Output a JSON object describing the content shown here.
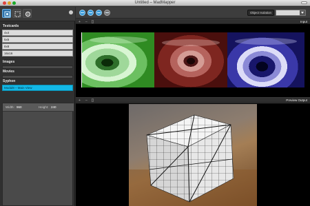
{
  "window": {
    "title": "Untitled – MadMapper"
  },
  "toolbar": {
    "tools": [
      {
        "name": "quad-tool-icon",
        "active": true
      },
      {
        "name": "mask-tool-icon",
        "active": false
      },
      {
        "name": "settings-tool-icon",
        "active": false
      }
    ]
  },
  "sidebar": {
    "testcards_label": "Testcards",
    "testcards": [
      "4x4",
      "5x5",
      "8x8",
      "16x16"
    ],
    "images_label": "Images",
    "movies_label": "Movies",
    "syphon_label": "Syphon",
    "syphon_items": [
      "Modul8 – Main View"
    ],
    "selected_syphon": 0,
    "width_label": "Width:",
    "width_value": "960",
    "height_label": "Height:",
    "height_value": "240"
  },
  "main": {
    "object_isolation_label": "Object Isolation",
    "input_pane_title": "Input",
    "preview_pane_title": "Preview Output",
    "pane_controls": [
      "+",
      "–",
      "[]"
    ]
  },
  "colors": {
    "accent": "#13b8e6",
    "button_blue": "#3a9ad8",
    "panel_dark": "#303030"
  }
}
